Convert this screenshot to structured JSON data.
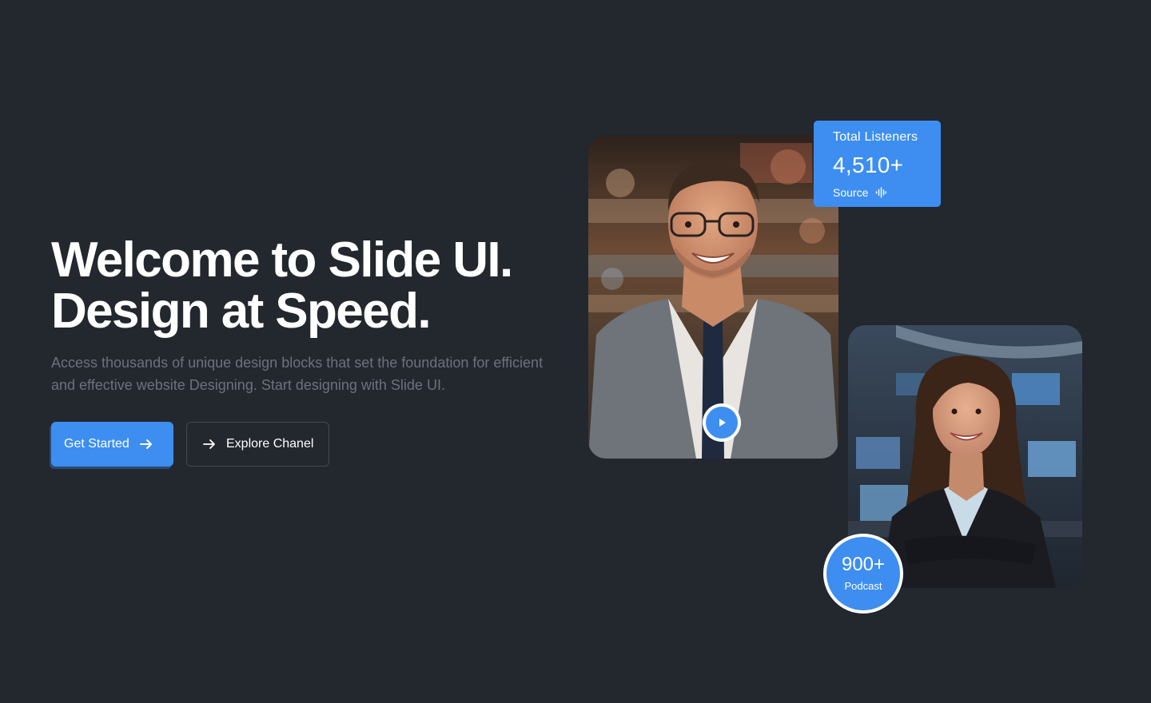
{
  "hero": {
    "title_line1": "Welcome to Slide UI.",
    "title_line2": "Design at Speed.",
    "description": "Access thousands of unique design blocks that set the foundation for efficient and effective website Designing. Start designing with Slide UI."
  },
  "actions": {
    "primary_label": "Get Started",
    "primary_icon": "arrow-right-icon",
    "secondary_label": "Explore Chanel",
    "secondary_icon": "arrow-right-icon"
  },
  "stats_card": {
    "label": "Total Listeners",
    "value": "4,510+",
    "source_label": "Source",
    "source_icon": "audio-wave-icon"
  },
  "podcast_badge": {
    "value": "900+",
    "label": "Podcast"
  },
  "media": {
    "man_photo": "smiling-man-in-suit-photo",
    "woman_photo": "smiling-businesswoman-photo",
    "play_icon": "play-icon"
  },
  "colors": {
    "background": "#23272e",
    "accent": "#3d8ef0",
    "text_primary": "#ffffff",
    "text_muted": "#6b727d",
    "button_border": "#444a53"
  }
}
